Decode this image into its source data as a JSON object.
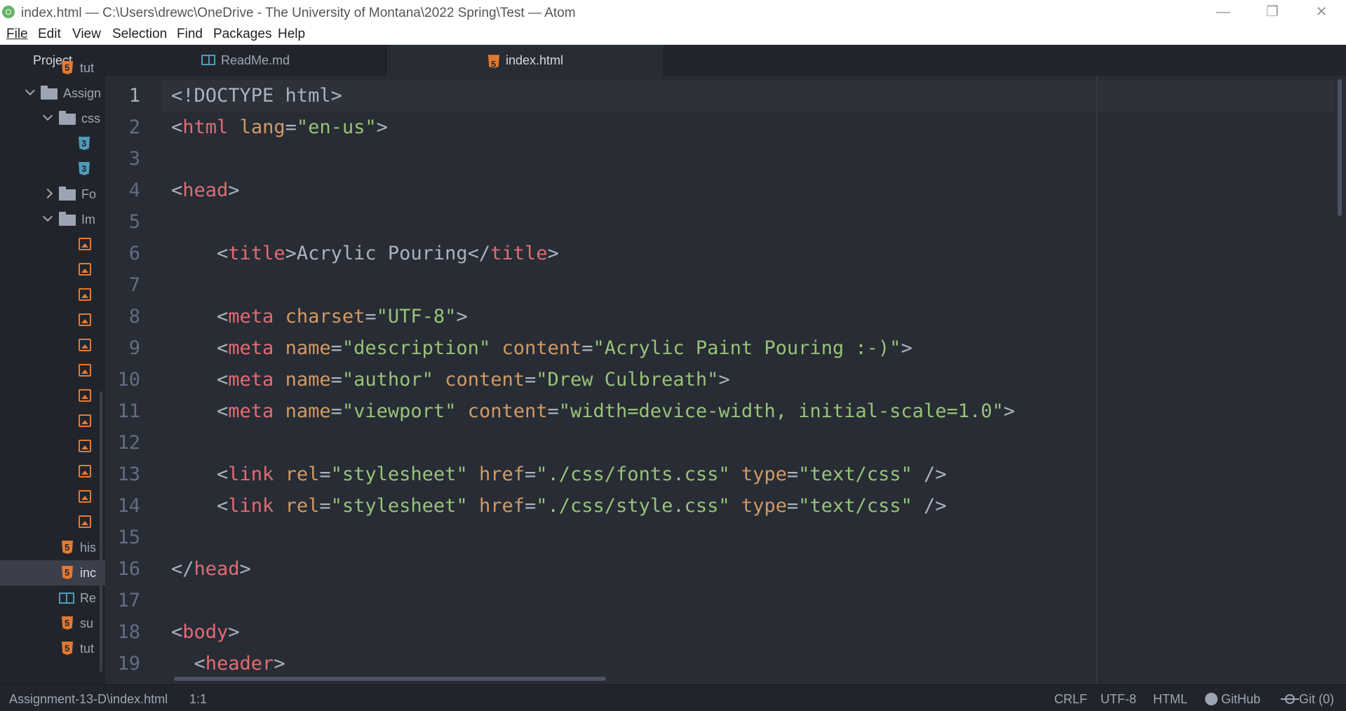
{
  "window": {
    "title": "index.html — C:\\Users\\drewc\\OneDrive - The University of Montana\\2022 Spring\\Test — Atom",
    "minimize_icon": "—",
    "restore_icon": "❐",
    "close_icon": "✕"
  },
  "menu": [
    "File",
    "Edit",
    "View",
    "Selection",
    "Find",
    "Packages",
    "Help"
  ],
  "sidebar": {
    "title": "Project",
    "rows": [
      {
        "kind": "html",
        "label": "tut"
      },
      {
        "kind": "folder",
        "state": "open",
        "label": "Assign"
      },
      {
        "kind": "folder",
        "state": "open",
        "label": "css"
      },
      {
        "kind": "css",
        "label": ""
      },
      {
        "kind": "css",
        "label": ""
      },
      {
        "kind": "folder",
        "state": "closed",
        "label": "Fo"
      },
      {
        "kind": "folder",
        "state": "open",
        "label": "Im"
      },
      {
        "kind": "image",
        "label": ""
      },
      {
        "kind": "image",
        "label": ""
      },
      {
        "kind": "image",
        "label": ""
      },
      {
        "kind": "image",
        "label": ""
      },
      {
        "kind": "image",
        "label": ""
      },
      {
        "kind": "image",
        "label": ""
      },
      {
        "kind": "image",
        "label": ""
      },
      {
        "kind": "image",
        "label": ""
      },
      {
        "kind": "image",
        "label": ""
      },
      {
        "kind": "image",
        "label": ""
      },
      {
        "kind": "image",
        "label": ""
      },
      {
        "kind": "image",
        "label": ""
      },
      {
        "kind": "html",
        "label": "his"
      },
      {
        "kind": "html",
        "label": "inc",
        "selected": true
      },
      {
        "kind": "markdown",
        "label": "Re"
      },
      {
        "kind": "html",
        "label": "su"
      },
      {
        "kind": "html",
        "label": "tut"
      }
    ]
  },
  "tabs": [
    {
      "label": "ReadMe.md",
      "icon": "book-icon",
      "active": false
    },
    {
      "label": "index.html",
      "icon": "html5-icon",
      "active": true
    }
  ],
  "editor": {
    "current_line": 1,
    "lines": [
      [
        [
          "p",
          "<!DOCTYPE html>"
        ]
      ],
      [
        [
          "p",
          "<"
        ],
        [
          "t",
          "html"
        ],
        [
          "p",
          " "
        ],
        [
          "a",
          "lang"
        ],
        [
          "p",
          "="
        ],
        [
          "s",
          "\"en-us\""
        ],
        [
          "p",
          ">"
        ]
      ],
      [],
      [
        [
          "p",
          "<"
        ],
        [
          "t",
          "head"
        ],
        [
          "p",
          ">"
        ]
      ],
      [],
      [
        [
          "p",
          "    <"
        ],
        [
          "t",
          "title"
        ],
        [
          "p",
          ">Acrylic Pouring</"
        ],
        [
          "t",
          "title"
        ],
        [
          "p",
          ">"
        ]
      ],
      [],
      [
        [
          "p",
          "    <"
        ],
        [
          "t",
          "meta"
        ],
        [
          "p",
          " "
        ],
        [
          "a",
          "charset"
        ],
        [
          "p",
          "="
        ],
        [
          "s",
          "\"UTF-8\""
        ],
        [
          "p",
          ">"
        ]
      ],
      [
        [
          "p",
          "    <"
        ],
        [
          "t",
          "meta"
        ],
        [
          "p",
          " "
        ],
        [
          "a",
          "name"
        ],
        [
          "p",
          "="
        ],
        [
          "s",
          "\"description\""
        ],
        [
          "p",
          " "
        ],
        [
          "a",
          "content"
        ],
        [
          "p",
          "="
        ],
        [
          "s",
          "\"Acrylic Paint Pouring :-)\""
        ],
        [
          "p",
          ">"
        ]
      ],
      [
        [
          "p",
          "    <"
        ],
        [
          "t",
          "meta"
        ],
        [
          "p",
          " "
        ],
        [
          "a",
          "name"
        ],
        [
          "p",
          "="
        ],
        [
          "s",
          "\"author\""
        ],
        [
          "p",
          " "
        ],
        [
          "a",
          "content"
        ],
        [
          "p",
          "="
        ],
        [
          "s",
          "\"Drew Culbreath\""
        ],
        [
          "p",
          ">"
        ]
      ],
      [
        [
          "p",
          "    <"
        ],
        [
          "t",
          "meta"
        ],
        [
          "p",
          " "
        ],
        [
          "a",
          "name"
        ],
        [
          "p",
          "="
        ],
        [
          "s",
          "\"viewport\""
        ],
        [
          "p",
          " "
        ],
        [
          "a",
          "content"
        ],
        [
          "p",
          "="
        ],
        [
          "s",
          "\"width=device-width, initial-scale=1.0\""
        ],
        [
          "p",
          ">"
        ]
      ],
      [],
      [
        [
          "p",
          "    <"
        ],
        [
          "t",
          "link"
        ],
        [
          "p",
          " "
        ],
        [
          "a",
          "rel"
        ],
        [
          "p",
          "="
        ],
        [
          "s",
          "\"stylesheet\""
        ],
        [
          "p",
          " "
        ],
        [
          "a",
          "href"
        ],
        [
          "p",
          "="
        ],
        [
          "s",
          "\"./css/fonts.css\""
        ],
        [
          "p",
          " "
        ],
        [
          "a",
          "type"
        ],
        [
          "p",
          "="
        ],
        [
          "s",
          "\"text/css\""
        ],
        [
          "p",
          " />"
        ]
      ],
      [
        [
          "p",
          "    <"
        ],
        [
          "t",
          "link"
        ],
        [
          "p",
          " "
        ],
        [
          "a",
          "rel"
        ],
        [
          "p",
          "="
        ],
        [
          "s",
          "\"stylesheet\""
        ],
        [
          "p",
          " "
        ],
        [
          "a",
          "href"
        ],
        [
          "p",
          "="
        ],
        [
          "s",
          "\"./css/style.css\""
        ],
        [
          "p",
          " "
        ],
        [
          "a",
          "type"
        ],
        [
          "p",
          "="
        ],
        [
          "s",
          "\"text/css\""
        ],
        [
          "p",
          " />"
        ]
      ],
      [],
      [
        [
          "p",
          "</"
        ],
        [
          "t",
          "head"
        ],
        [
          "p",
          ">"
        ]
      ],
      [],
      [
        [
          "p",
          "<"
        ],
        [
          "t",
          "body"
        ],
        [
          "p",
          ">"
        ]
      ],
      [
        [
          "p",
          "  <"
        ],
        [
          "t",
          "header"
        ],
        [
          "p",
          ">"
        ]
      ]
    ]
  },
  "statusbar": {
    "path": "Assignment-13-D\\index.html",
    "cursor": "1:1",
    "line_ending": "CRLF",
    "encoding": "UTF-8",
    "grammar": "HTML",
    "github": "GitHub",
    "git": "Git (0)"
  },
  "colors": {
    "tag": "#e06c75",
    "attribute": "#d19a66",
    "string": "#98c379",
    "plain": "#abb2bf",
    "editor_bg": "#282c34",
    "panel_bg": "#21252b"
  }
}
